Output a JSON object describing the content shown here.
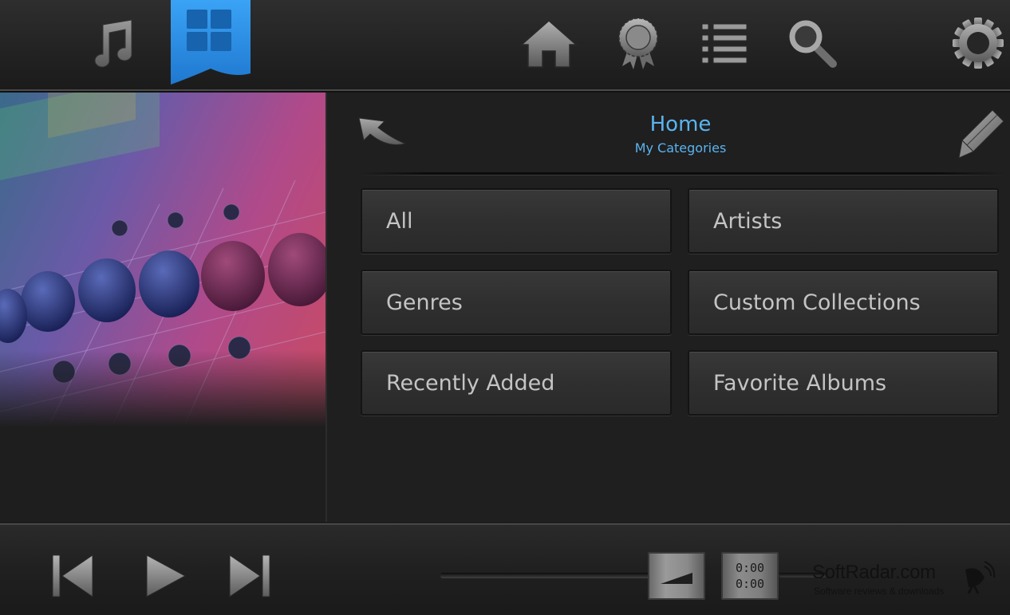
{
  "top_nav": {
    "icons": [
      "music-note-icon",
      "categories-grid-icon",
      "home-icon",
      "award-icon",
      "list-icon",
      "search-icon",
      "settings-gear-icon"
    ],
    "active": "categories-grid-icon",
    "accent_color": "#2f8ee0"
  },
  "header": {
    "title": "Home",
    "subtitle": "My Categories",
    "title_color": "#5ab4f0"
  },
  "categories": [
    {
      "label": "All"
    },
    {
      "label": "Artists"
    },
    {
      "label": "Genres"
    },
    {
      "label": "Custom Collections"
    },
    {
      "label": "Recently Added"
    },
    {
      "label": "Favorite Albums"
    }
  ],
  "player": {
    "controls": [
      "previous-icon",
      "play-icon",
      "next-icon"
    ],
    "elapsed": "0:00",
    "total": "0:00"
  },
  "watermark": {
    "title": "SoftRadar.com",
    "subtitle": "Software reviews & downloads"
  }
}
